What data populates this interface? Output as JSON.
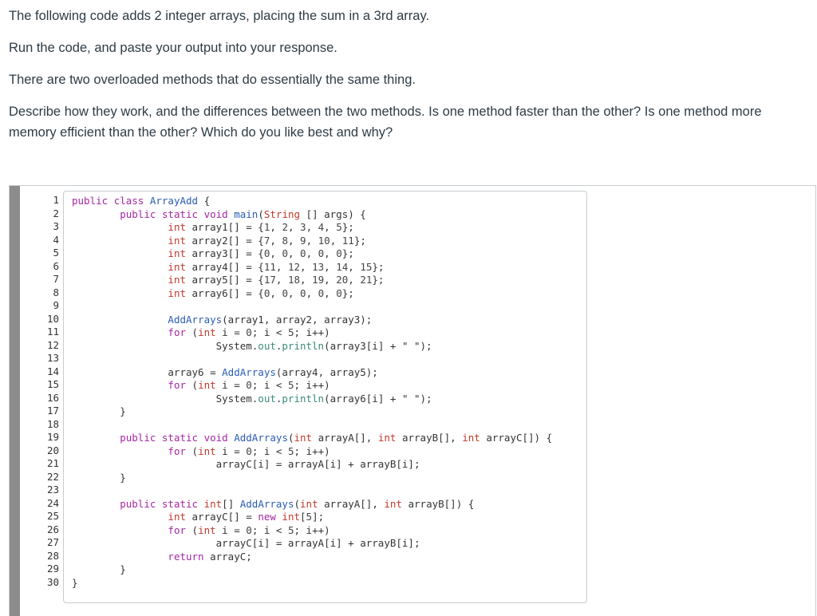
{
  "question": {
    "p1": "The following code adds 2 integer arrays, placing the sum in a 3rd array.",
    "p2": "Run the code, and paste your output into your response.",
    "p3": "There are two overloaded methods that do essentially the same thing.",
    "p4": "Describe how they work, and the differences between the two methods. Is one method faster than the other? Is one method more memory efficient than the other? Which do you like best and why?"
  },
  "colors": {
    "keyword": "#a626a4",
    "type": "#c0392b",
    "identifier": "#2a5db0",
    "number": "#444444",
    "string": "#333333",
    "field": "#3b8a7a",
    "text": "#333333"
  },
  "code": {
    "line_numbers": [
      "1",
      "2",
      "3",
      "4",
      "5",
      "6",
      "7",
      "8",
      "9",
      "10",
      "11",
      "12",
      "13",
      "14",
      "15",
      "16",
      "17",
      "18",
      "19",
      "20",
      "21",
      "22",
      "23",
      "24",
      "25",
      "26",
      "27",
      "28",
      "29",
      "30"
    ],
    "lines": [
      "public class ArrayAdd {",
      "        public static void main(String [] args) {",
      "                int array1[] = {1, 2, 3, 4, 5};",
      "                int array2[] = {7, 8, 9, 10, 11};",
      "                int array3[] = {0, 0, 0, 0, 0};",
      "                int array4[] = {11, 12, 13, 14, 15};",
      "                int array5[] = {17, 18, 19, 20, 21};",
      "                int array6[] = {0, 0, 0, 0, 0};",
      "",
      "                AddArrays(array1, array2, array3);",
      "                for (int i = 0; i < 5; i++)",
      "                        System.out.println(array3[i] + \" \");",
      "",
      "                array6 = AddArrays(array4, array5);",
      "                for (int i = 0; i < 5; i++)",
      "                        System.out.println(array6[i] + \" \");",
      "        }",
      "",
      "        public static void AddArrays(int arrayA[], int arrayB[], int arrayC[]) {",
      "                for (int i = 0; i < 5; i++)",
      "                        arrayC[i] = arrayA[i] + arrayB[i];",
      "        }",
      "",
      "        public static int[] AddArrays(int arrayA[], int arrayB[]) {",
      "                int arrayC[] = new int[5];",
      "                for (int i = 0; i < 5; i++)",
      "                        arrayC[i] = arrayA[i] + arrayB[i];",
      "                return arrayC;",
      "        }",
      "}"
    ]
  }
}
